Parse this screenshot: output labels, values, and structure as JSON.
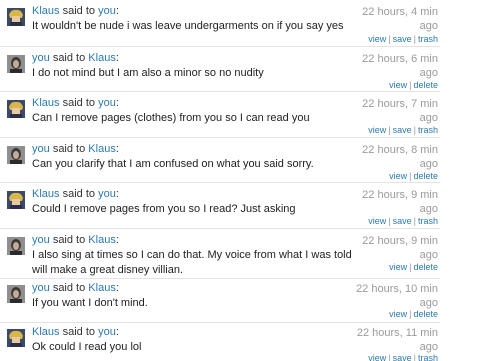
{
  "messages": [
    {
      "from": "Klaus",
      "to": "you",
      "said_to": "said to",
      "text": "It wouldn't be nude i was leave undergarments on if you say yes",
      "time_line1": "22 hours, 4 min",
      "time_line2": "ago",
      "actions": [
        "view",
        "save",
        "trash"
      ],
      "avatar": "klaus-avatar"
    },
    {
      "from": "you",
      "to": "Klaus",
      "said_to": "said to",
      "text": "I do not mind but I am also a minor so no nudity",
      "time_line1": "22 hours, 6 min",
      "time_line2": "ago",
      "actions": [
        "view",
        "delete"
      ],
      "avatar": "you-avatar"
    },
    {
      "from": "Klaus",
      "to": "you",
      "said_to": "said to",
      "text": "Can I remove pages (clothes) from you so I can read you",
      "time_line1": "22 hours, 7 min",
      "time_line2": "ago",
      "actions": [
        "view",
        "save",
        "trash"
      ],
      "avatar": "klaus-avatar"
    },
    {
      "from": "you",
      "to": "Klaus",
      "said_to": "said to",
      "text": "Can you clarify that I am confused on what you said sorry.",
      "time_line1": "22 hours, 8 min",
      "time_line2": "ago",
      "actions": [
        "view",
        "delete"
      ],
      "avatar": "you-avatar"
    },
    {
      "from": "Klaus",
      "to": "you",
      "said_to": "said to",
      "text": "Could I remove pages from you so I read? Just asking",
      "time_line1": "22 hours, 9 min",
      "time_line2": "ago",
      "actions": [
        "view",
        "save",
        "trash"
      ],
      "avatar": "klaus-avatar"
    },
    {
      "from": "you",
      "to": "Klaus",
      "said_to": "said to",
      "text": "I also sing at times so I can do that. My voice from what I was told will make a great disney villian.",
      "time_line1": "22 hours, 9 min",
      "time_line2": "ago",
      "actions": [
        "view",
        "delete"
      ],
      "avatar": "you-avatar"
    },
    {
      "from": "you",
      "to": "Klaus",
      "said_to": "said to",
      "text": "If you want I don't mind.",
      "time_line1": "22 hours, 10 min",
      "time_line2": "ago",
      "actions": [
        "view",
        "delete"
      ],
      "avatar": "you-avatar"
    },
    {
      "from": "Klaus",
      "to": "you",
      "said_to": "said to",
      "text": "Ok could I read you lol",
      "time_line1": "22 hours, 11 min",
      "time_line2": "ago",
      "actions": [
        "view",
        "save",
        "trash"
      ],
      "avatar": "klaus-avatar"
    }
  ]
}
